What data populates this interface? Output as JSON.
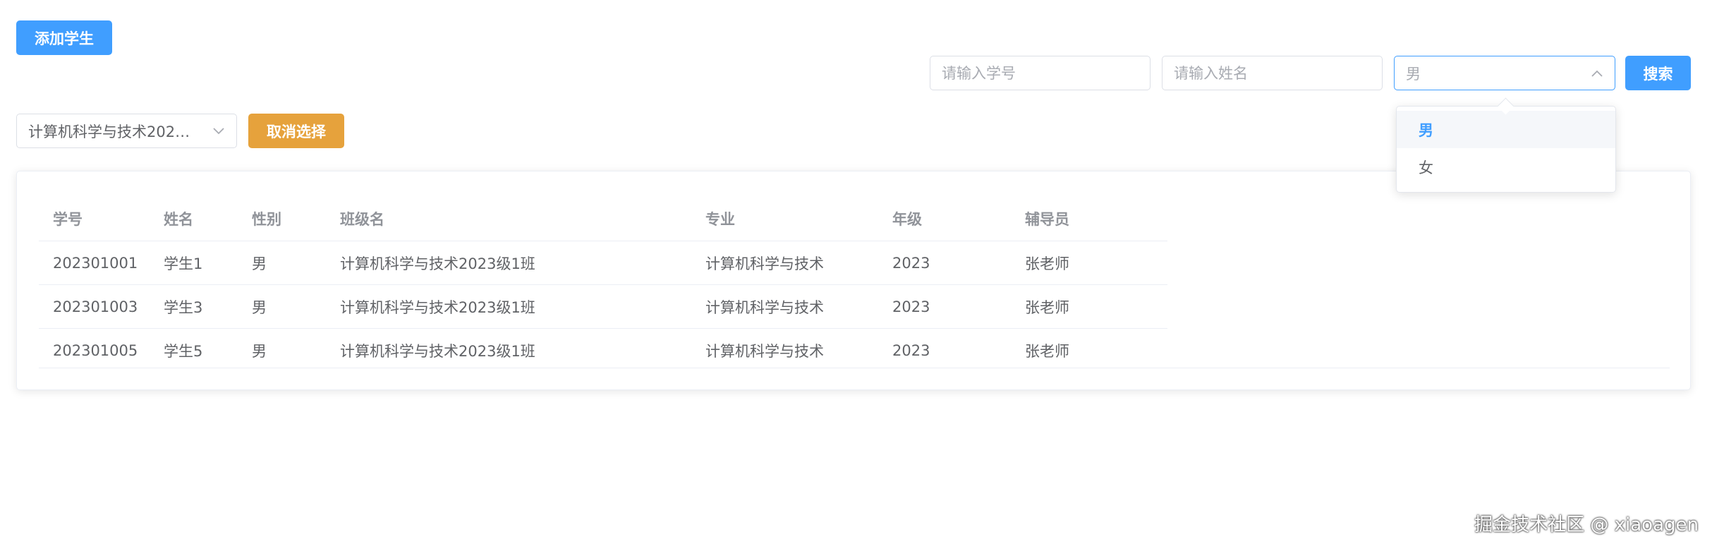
{
  "toolbar": {
    "add_student_label": "添加学生",
    "student_id_placeholder": "请输入学号",
    "name_placeholder": "请输入姓名",
    "gender_value": "男",
    "search_label": "搜索"
  },
  "class_filter": {
    "selected_value": "计算机科学与技术202…",
    "cancel_label": "取消选择"
  },
  "gender_dropdown": {
    "options": [
      {
        "label": "男",
        "selected": true
      },
      {
        "label": "女",
        "selected": false
      }
    ]
  },
  "table": {
    "columns": [
      "学号",
      "姓名",
      "性别",
      "班级名",
      "专业",
      "年级",
      "辅导员"
    ],
    "rows": [
      [
        "202301001",
        "学生1",
        "男",
        "计算机科学与技术2023级1班",
        "计算机科学与技术",
        "2023",
        "张老师"
      ],
      [
        "202301003",
        "学生3",
        "男",
        "计算机科学与技术2023级1班",
        "计算机科学与技术",
        "2023",
        "张老师"
      ],
      [
        "202301005",
        "学生5",
        "男",
        "计算机科学与技术2023级1班",
        "计算机科学与技术",
        "2023",
        "张老师"
      ]
    ]
  },
  "watermark": "掘金技术社区 @ xiaoagen",
  "colors": {
    "primary": "#409eff",
    "warning": "#e6a23c",
    "border": "#dcdfe6",
    "text": "#606266",
    "header_text": "#909399"
  },
  "icons": [
    "chevron-down-icon",
    "chevron-up-icon"
  ]
}
